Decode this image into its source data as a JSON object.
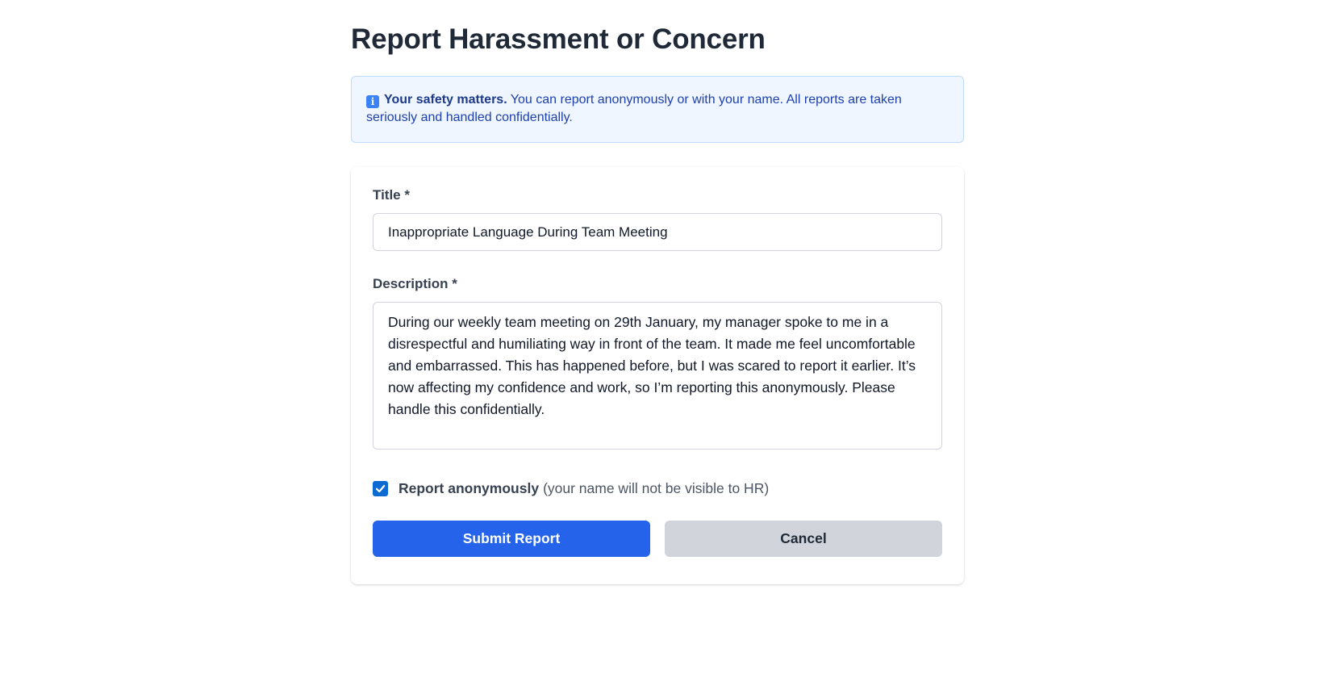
{
  "page": {
    "title": "Report Harassment or Concern"
  },
  "notice": {
    "icon": "info-icon",
    "icon_glyph": "i",
    "strong": "Your safety matters.",
    "text": " You can report anonymously or with your name. All reports are taken seriously and handled confidentially."
  },
  "form": {
    "title_label": "Title *",
    "title_value": "Inappropriate Language During Team Meeting",
    "description_label": "Description *",
    "description_value": "During our weekly team meeting on 29th January, my manager spoke to me in a disrespectful and humiliating way in front of the team. It made me feel uncomfortable and embarrassed. This has happened before, but I was scared to report it earlier. It’s now affecting my confidence and work, so I’m reporting this anonymously. Please handle this confidentially.",
    "anonymous_checked": true,
    "anonymous_label": "Report anonymously",
    "anonymous_hint": "(your name will not be visible to HR)",
    "submit_label": "Submit Report",
    "cancel_label": "Cancel"
  },
  "colors": {
    "primary": "#2563eb",
    "secondary": "#d1d5db",
    "notice_bg": "#eff6ff",
    "notice_text": "#1e40af",
    "checkbox": "#0b6bd3"
  }
}
